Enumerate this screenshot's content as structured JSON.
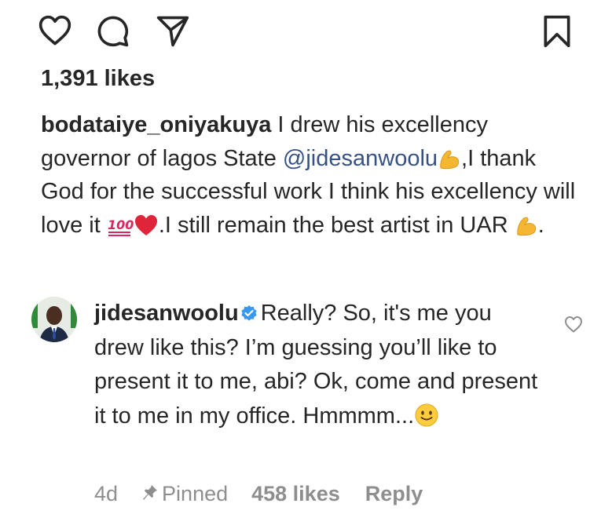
{
  "post": {
    "likes_text": "1,391 likes",
    "caption": {
      "username": "bodataiye_oniyakuya",
      "part1": " I drew his excellency governor of lagos State ",
      "mention": "@jidesanwoolu",
      "part2": ",I thank God for the successful work I think his excellency will love it ",
      "part3": ".I still remain the best artist in UAR ",
      "part4": "."
    }
  },
  "comment": {
    "username": "jidesanwoolu",
    "text": "Really? So, it's me you drew like this? I’m guessing you’ll like to present it to me, abi? Ok, come and present it to me in my office. Hmmmm...",
    "time": "4d",
    "pinned_label": "Pinned",
    "likes_text": "458 likes",
    "reply_label": "Reply"
  },
  "icons": {
    "like": "heart-icon",
    "comment": "comment-bubble-icon",
    "share": "send-icon",
    "save": "bookmark-icon",
    "verified": "verified-badge-icon",
    "pin": "pin-icon"
  },
  "colors": {
    "text": "#262626",
    "secondary": "#8e8e8e",
    "mention": "#385185",
    "verified": "#3897f0"
  }
}
